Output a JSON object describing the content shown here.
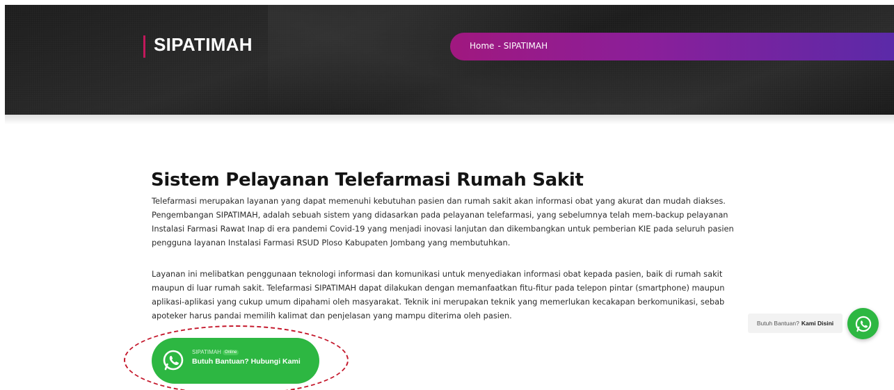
{
  "hero": {
    "title": "SIPATIMAH",
    "breadcrumb": {
      "home": "Home",
      "separator": "-",
      "current": "SIPATIMAH"
    }
  },
  "main": {
    "heading": "Sistem Pelayanan Telefarmasi Rumah Sakit",
    "paragraphs": [
      "Telefarmasi merupakan layanan yang dapat memenuhi kebutuhan pasien dan rumah sakit akan informasi obat yang akurat dan mudah diakses. Pengembangan SIPATIMAH, adalah sebuah sistem yang didasarkan pada pelayanan telefarmasi, yang sebelumnya telah mem-backup pelayanan Instalasi Farmasi Rawat Inap di era pandemi Covid-19 yang menjadi inovasi lanjutan dan dikembangkan untuk pemberian KIE pada seluruh pasien pengguna layanan Instalasi Farmasi RSUD Ploso Kabupaten Jombang yang membutuhkan.",
      "Layanan ini melibatkan penggunaan teknologi informasi dan komunikasi untuk menyediakan informasi obat kepada pasien, baik di rumah sakit maupun di luar rumah sakit. Telefarmasi SIPATIMAH dapat dilakukan dengan memanfaatkan fitu-fitur pada telepon pintar (smartphone) maupun aplikasi-aplikasi yang cukup umum dipahami oleh masyarakat. Teknik ini merupakan teknik yang memerlukan kecakapan berkomunikasi, sebab apoteker harus pandai memilih kalimat dan penjelasan yang mampu diterima oleh pasien."
    ]
  },
  "whatsapp_card": {
    "agent_name": "SIPATIMAH",
    "status": "Online",
    "cta": "Butuh Bantuan? Hubungi Kami",
    "icon": "whatsapp-icon"
  },
  "floating_help": {
    "label": "Butuh Bantuan?",
    "label_bold": "Kami Disini",
    "icon": "whatsapp-icon"
  },
  "colors": {
    "accent_magenta": "#c2185b",
    "breadcrumb_gradient_start": "#a0187f",
    "breadcrumb_gradient_end": "#5b2aa8",
    "whatsapp_green": "#2db742",
    "annotation_red": "#c4162a"
  }
}
